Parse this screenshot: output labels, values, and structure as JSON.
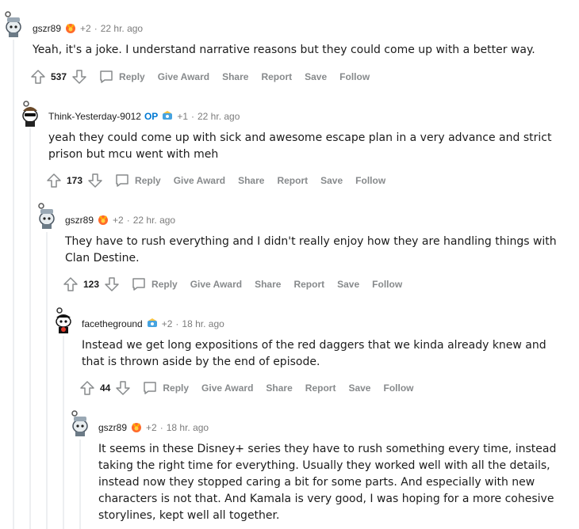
{
  "comments": [
    {
      "author": "gszr89",
      "op": "",
      "karma": "+2",
      "time": "22 hr. ago",
      "text": "Yeah, it's a joke. I understand narrative reasons but they could come up with a better way.",
      "score": "537"
    },
    {
      "author": "Think-Yesterday-9012",
      "op": "OP",
      "karma": "+1",
      "time": "22 hr. ago",
      "text": "yeah they could come up with sick and awesome escape plan in a very advance and strict prison but mcu went with meh",
      "score": "173"
    },
    {
      "author": "gszr89",
      "op": "",
      "karma": "+2",
      "time": "22 hr. ago",
      "text": "They have to rush everything and I didn't really enjoy how they are handling things with Clan Destine.",
      "score": "123"
    },
    {
      "author": "facetheground",
      "op": "",
      "karma": "+2",
      "time": "18 hr. ago",
      "text": "Instead we get long expositions of the red daggers that we kinda already knew and that is thrown aside by the end of episode.",
      "score": "44"
    },
    {
      "author": "gszr89",
      "op": "",
      "karma": "+2",
      "time": "18 hr. ago",
      "text": "It seems in these Disney+ series they have to rush something every time, instead taking the right time for everything. Usually they worked well with all the details, instead now they stopped caring a bit for some parts. And especially with new characters is not that. And Kamala is very good, I was hoping for a more cohesive storylines, kept well all together.",
      "score": ""
    }
  ],
  "actions": {
    "reply": "Reply",
    "give_award": "Give Award",
    "share": "Share",
    "report": "Report",
    "save": "Save",
    "follow": "Follow"
  },
  "separator": "·",
  "icons": {
    "upvote": "upvote-icon",
    "downvote": "downvote-icon",
    "reply": "comment-bubble-icon",
    "award": "award-icon",
    "avatar": "snoo-avatar-icon"
  },
  "colors": {
    "op": "#0079d3",
    "meta": "#7c7c7c",
    "action": "#878a8c",
    "thread_line": "#edeff1"
  }
}
